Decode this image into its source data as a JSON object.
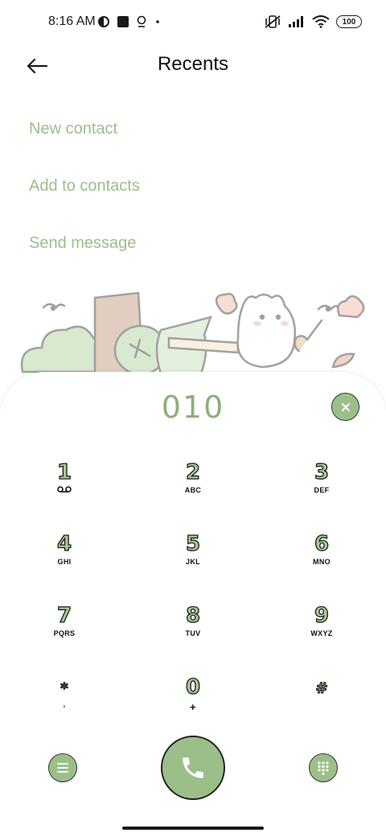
{
  "status_bar": {
    "time": "8:16 AM",
    "battery": "100"
  },
  "header": {
    "title": "Recents"
  },
  "actions": {
    "new_contact": "New contact",
    "add_to_contacts": "Add to contacts",
    "send_message": "Send message"
  },
  "dialpad": {
    "number": "010",
    "keys": [
      {
        "digit": "1",
        "letters": ""
      },
      {
        "digit": "2",
        "letters": "ABC"
      },
      {
        "digit": "3",
        "letters": "DEF"
      },
      {
        "digit": "4",
        "letters": "GHI"
      },
      {
        "digit": "5",
        "letters": "JKL"
      },
      {
        "digit": "6",
        "letters": "MNO"
      },
      {
        "digit": "7",
        "letters": "PQRS"
      },
      {
        "digit": "8",
        "letters": "TUV"
      },
      {
        "digit": "9",
        "letters": "WXYZ"
      },
      {
        "digit": "*",
        "letters": ","
      },
      {
        "digit": "0",
        "letters": "+"
      },
      {
        "digit": "#",
        "letters": ""
      }
    ]
  },
  "colors": {
    "accent": "#9cbf8a",
    "accent_text": "#9dbd8c",
    "number": "#8db07a"
  },
  "icons": {
    "back": "arrow-left-icon",
    "clear": "close-icon",
    "menu": "menu-icon",
    "call": "phone-icon",
    "keypad": "dialpad-icon",
    "voicemail": "voicemail-icon"
  }
}
